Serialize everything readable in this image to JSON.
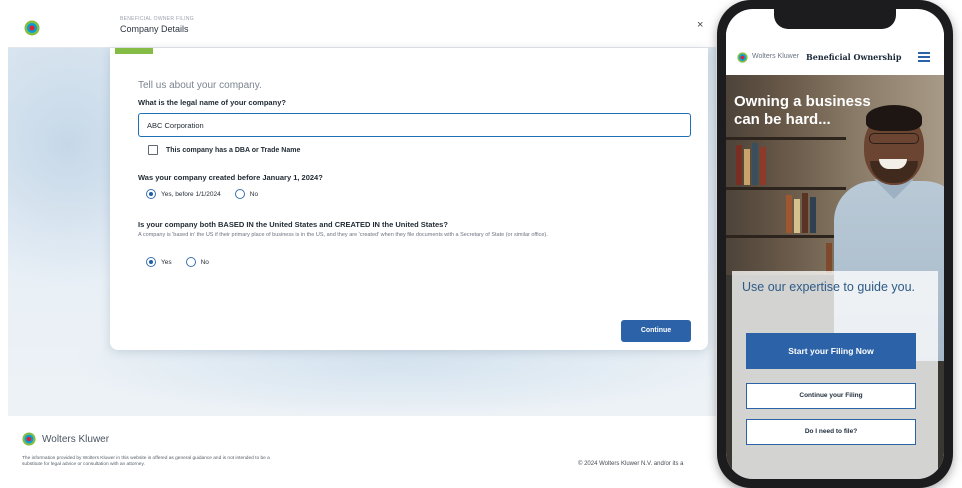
{
  "desktop": {
    "eyebrow": "BENEFICIAL OWNER FILING",
    "title": "Company Details",
    "close_glyph": "×"
  },
  "form": {
    "intro": "Tell us about your company.",
    "q1": {
      "label": "What is the legal name of your company?",
      "value": "ABC Corporation",
      "dba_label": "This company has a DBA or Trade Name",
      "dba_checked": false
    },
    "q2": {
      "label": "Was your company created before January 1, 2024?",
      "options": [
        "Yes, before 1/1/2024",
        "No"
      ],
      "selected": "Yes, before 1/1/2024"
    },
    "q3": {
      "label": "Is your company both BASED IN the United States and CREATED IN the United States?",
      "help": "A company is 'based in' the US if their primary place of business is in the US, and they are 'created' when they file documents with a Secretary of State (or similar office).",
      "options": [
        "Yes",
        "No"
      ],
      "selected": "Yes"
    },
    "continue_label": "Continue"
  },
  "footer": {
    "brand": "Wolters Kluwer",
    "disclaimer": "The information provided by Wolters Kluwer in this website is offered as general guidance and is not intended to be a substitute for legal advice or consultation with an attorney.",
    "copyright": "© 2024 Wolters Kluwer N.V. and/or its a"
  },
  "mobile": {
    "brand": "Wolters Kluwer",
    "product": "Beneficial Ownership",
    "hero_heading": "Owning a business can be hard...",
    "card_heading": "Use our expertise to guide you.",
    "primary_button": "Start your Filing Now",
    "continue_button": "Continue your Filing",
    "need_button": "Do I need to file?"
  },
  "colors": {
    "brand_blue": "#2b62a8",
    "progress_green": "#85bc45",
    "heading_blue": "#2e5b86"
  },
  "icons": {
    "logo": "wolters-kluwer-logo-icon",
    "menu": "hamburger-menu-icon",
    "close": "close-icon"
  }
}
